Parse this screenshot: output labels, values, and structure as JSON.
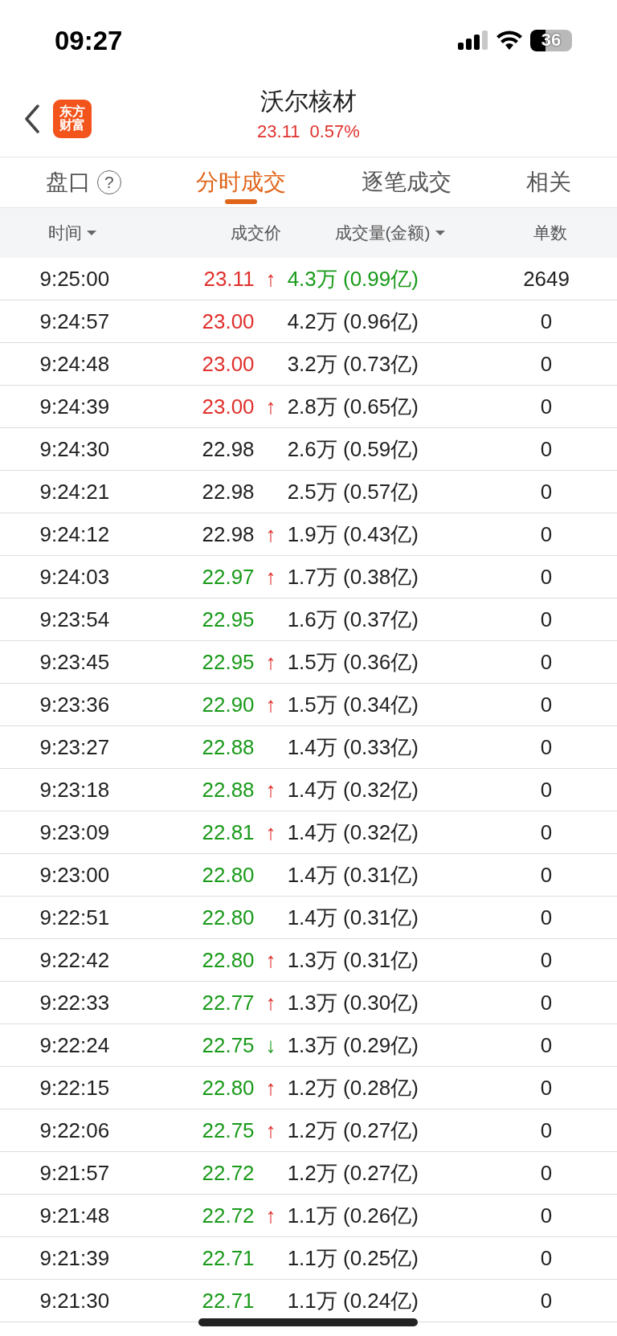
{
  "status_bar": {
    "time": "09:27",
    "battery": "36"
  },
  "header": {
    "logo_lines": [
      "东方",
      "财富"
    ],
    "title": "沃尔核材",
    "price": "23.11",
    "change": "0.57%"
  },
  "tabs": [
    {
      "label": "盘口",
      "help": "?",
      "selected": false
    },
    {
      "label": "分时成交",
      "selected": true
    },
    {
      "label": "逐笔成交",
      "selected": false
    },
    {
      "label": "相关",
      "selected": false
    }
  ],
  "table": {
    "columns": [
      {
        "label": "时间",
        "sortable": true
      },
      {
        "label": "成交价",
        "sortable": false
      },
      {
        "label": "成交量(金额)",
        "sortable": true
      },
      {
        "label": "单数",
        "sortable": false
      }
    ],
    "rows": [
      {
        "time": "9:25:00",
        "price": {
          "text": "23.11",
          "color": "#e0312d"
        },
        "arrow": {
          "text": "↑",
          "color": "#e0312d"
        },
        "volume": {
          "text": "4.3万 (0.99亿)",
          "color": "#1a9a1a"
        },
        "count": "2649"
      },
      {
        "time": "9:24:57",
        "price": {
          "text": "23.00",
          "color": "#e0312d"
        },
        "volume": {
          "text": "4.2万 (0.96亿)",
          "color": "#222222"
        },
        "count": "0"
      },
      {
        "time": "9:24:48",
        "price": {
          "text": "23.00",
          "color": "#e0312d"
        },
        "volume": {
          "text": "3.2万 (0.73亿)",
          "color": "#222222"
        },
        "count": "0"
      },
      {
        "time": "9:24:39",
        "price": {
          "text": "23.00",
          "color": "#e0312d"
        },
        "arrow": {
          "text": "↑",
          "color": "#e0312d"
        },
        "volume": {
          "text": "2.8万 (0.65亿)",
          "color": "#222222"
        },
        "count": "0"
      },
      {
        "time": "9:24:30",
        "price": {
          "text": "22.98",
          "color": "#222222"
        },
        "volume": {
          "text": "2.6万 (0.59亿)",
          "color": "#222222"
        },
        "count": "0"
      },
      {
        "time": "9:24:21",
        "price": {
          "text": "22.98",
          "color": "#222222"
        },
        "volume": {
          "text": "2.5万 (0.57亿)",
          "color": "#222222"
        },
        "count": "0"
      },
      {
        "time": "9:24:12",
        "price": {
          "text": "22.98",
          "color": "#222222"
        },
        "arrow": {
          "text": "↑",
          "color": "#e0312d"
        },
        "volume": {
          "text": "1.9万 (0.43亿)",
          "color": "#222222"
        },
        "count": "0"
      },
      {
        "time": "9:24:03",
        "price": {
          "text": "22.97",
          "color": "#1a9a1a"
        },
        "arrow": {
          "text": "↑",
          "color": "#e0312d"
        },
        "volume": {
          "text": "1.7万 (0.38亿)",
          "color": "#222222"
        },
        "count": "0"
      },
      {
        "time": "9:23:54",
        "price": {
          "text": "22.95",
          "color": "#1a9a1a"
        },
        "volume": {
          "text": "1.6万 (0.37亿)",
          "color": "#222222"
        },
        "count": "0"
      },
      {
        "time": "9:23:45",
        "price": {
          "text": "22.95",
          "color": "#1a9a1a"
        },
        "arrow": {
          "text": "↑",
          "color": "#e0312d"
        },
        "volume": {
          "text": "1.5万 (0.36亿)",
          "color": "#222222"
        },
        "count": "0"
      },
      {
        "time": "9:23:36",
        "price": {
          "text": "22.90",
          "color": "#1a9a1a"
        },
        "arrow": {
          "text": "↑",
          "color": "#e0312d"
        },
        "volume": {
          "text": "1.5万 (0.34亿)",
          "color": "#222222"
        },
        "count": "0"
      },
      {
        "time": "9:23:27",
        "price": {
          "text": "22.88",
          "color": "#1a9a1a"
        },
        "volume": {
          "text": "1.4万 (0.33亿)",
          "color": "#222222"
        },
        "count": "0"
      },
      {
        "time": "9:23:18",
        "price": {
          "text": "22.88",
          "color": "#1a9a1a"
        },
        "arrow": {
          "text": "↑",
          "color": "#e0312d"
        },
        "volume": {
          "text": "1.4万 (0.32亿)",
          "color": "#222222"
        },
        "count": "0"
      },
      {
        "time": "9:23:09",
        "price": {
          "text": "22.81",
          "color": "#1a9a1a"
        },
        "arrow": {
          "text": "↑",
          "color": "#e0312d"
        },
        "volume": {
          "text": "1.4万 (0.32亿)",
          "color": "#222222"
        },
        "count": "0"
      },
      {
        "time": "9:23:00",
        "price": {
          "text": "22.80",
          "color": "#1a9a1a"
        },
        "volume": {
          "text": "1.4万 (0.31亿)",
          "color": "#222222"
        },
        "count": "0"
      },
      {
        "time": "9:22:51",
        "price": {
          "text": "22.80",
          "color": "#1a9a1a"
        },
        "volume": {
          "text": "1.4万 (0.31亿)",
          "color": "#222222"
        },
        "count": "0"
      },
      {
        "time": "9:22:42",
        "price": {
          "text": "22.80",
          "color": "#1a9a1a"
        },
        "arrow": {
          "text": "↑",
          "color": "#e0312d"
        },
        "volume": {
          "text": "1.3万 (0.31亿)",
          "color": "#222222"
        },
        "count": "0"
      },
      {
        "time": "9:22:33",
        "price": {
          "text": "22.77",
          "color": "#1a9a1a"
        },
        "arrow": {
          "text": "↑",
          "color": "#e0312d"
        },
        "volume": {
          "text": "1.3万 (0.30亿)",
          "color": "#222222"
        },
        "count": "0"
      },
      {
        "time": "9:22:24",
        "price": {
          "text": "22.75",
          "color": "#1a9a1a"
        },
        "arrow": {
          "text": "↓",
          "color": "#1a9a1a"
        },
        "volume": {
          "text": "1.3万 (0.29亿)",
          "color": "#222222"
        },
        "count": "0"
      },
      {
        "time": "9:22:15",
        "price": {
          "text": "22.80",
          "color": "#1a9a1a"
        },
        "arrow": {
          "text": "↑",
          "color": "#e0312d"
        },
        "volume": {
          "text": "1.2万 (0.28亿)",
          "color": "#222222"
        },
        "count": "0"
      },
      {
        "time": "9:22:06",
        "price": {
          "text": "22.75",
          "color": "#1a9a1a"
        },
        "arrow": {
          "text": "↑",
          "color": "#e0312d"
        },
        "volume": {
          "text": "1.2万 (0.27亿)",
          "color": "#222222"
        },
        "count": "0"
      },
      {
        "time": "9:21:57",
        "price": {
          "text": "22.72",
          "color": "#1a9a1a"
        },
        "volume": {
          "text": "1.2万 (0.27亿)",
          "color": "#222222"
        },
        "count": "0"
      },
      {
        "time": "9:21:48",
        "price": {
          "text": "22.72",
          "color": "#1a9a1a"
        },
        "arrow": {
          "text": "↑",
          "color": "#e0312d"
        },
        "volume": {
          "text": "1.1万 (0.26亿)",
          "color": "#222222"
        },
        "count": "0"
      },
      {
        "time": "9:21:39",
        "price": {
          "text": "22.71",
          "color": "#1a9a1a"
        },
        "volume": {
          "text": "1.1万 (0.25亿)",
          "color": "#222222"
        },
        "count": "0"
      },
      {
        "time": "9:21:30",
        "price": {
          "text": "22.71",
          "color": "#1a9a1a"
        },
        "volume": {
          "text": "1.1万 (0.24亿)",
          "color": "#222222"
        },
        "count": "0"
      }
    ]
  }
}
